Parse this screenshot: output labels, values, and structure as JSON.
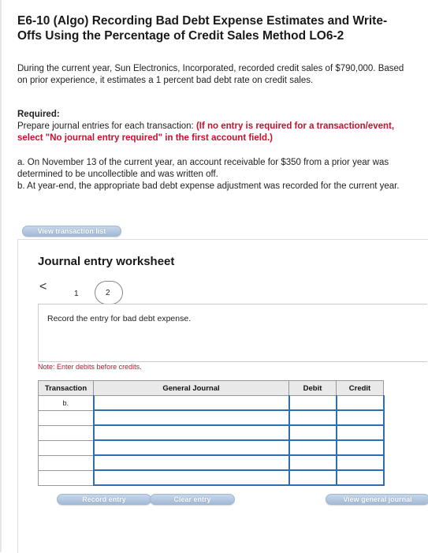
{
  "header": {
    "title": "E6-10 (Algo) Recording Bad Debt Expense Estimates and Write-Offs Using the Percentage of Credit Sales Method LO6-2"
  },
  "problem": {
    "intro": "During the current year, Sun Electronics, Incorporated, recorded credit sales of $790,000. Based on prior experience, it estimates a 1 percent bad debt rate on credit sales.",
    "required_label": "Required:",
    "required_text": "Prepare journal entries for each transaction: ",
    "required_note": "(If no entry is required for a transaction/event, select \"No journal entry required\" in the first account field.)",
    "item_a": "a. On November 13 of the current year, an account receivable for $350 from a prior year was determined to be uncollectible and was written off.",
    "item_b": "b. At year-end, the appropriate bad debt expense adjustment was recorded for the current year."
  },
  "buttons": {
    "view_transaction_list": "View transaction list",
    "record_entry": "Record entry",
    "clear_entry": "Clear entry",
    "view_general_journal": "View general journal"
  },
  "worksheet": {
    "title": "Journal entry worksheet",
    "prev_icon": "<",
    "pages": [
      "1",
      "2"
    ],
    "current_page": "2",
    "instruction": "Record the entry for bad debt expense.",
    "note_label": "Note:",
    "note_text": "Enter debits before credits.",
    "table": {
      "headers": [
        "Transaction",
        "General Journal",
        "Debit",
        "Credit"
      ],
      "rows": [
        {
          "transaction": "b.",
          "account": "",
          "debit": "",
          "credit": ""
        },
        {
          "transaction": "",
          "account": "",
          "debit": "",
          "credit": ""
        },
        {
          "transaction": "",
          "account": "",
          "debit": "",
          "credit": ""
        },
        {
          "transaction": "",
          "account": "",
          "debit": "",
          "credit": ""
        },
        {
          "transaction": "",
          "account": "",
          "debit": "",
          "credit": ""
        },
        {
          "transaction": "",
          "account": "",
          "debit": "",
          "credit": ""
        }
      ]
    }
  },
  "colors": {
    "required_red": "#c8102e",
    "input_border_blue": "#2e6fb4",
    "button_blue": "#a3bad6"
  }
}
